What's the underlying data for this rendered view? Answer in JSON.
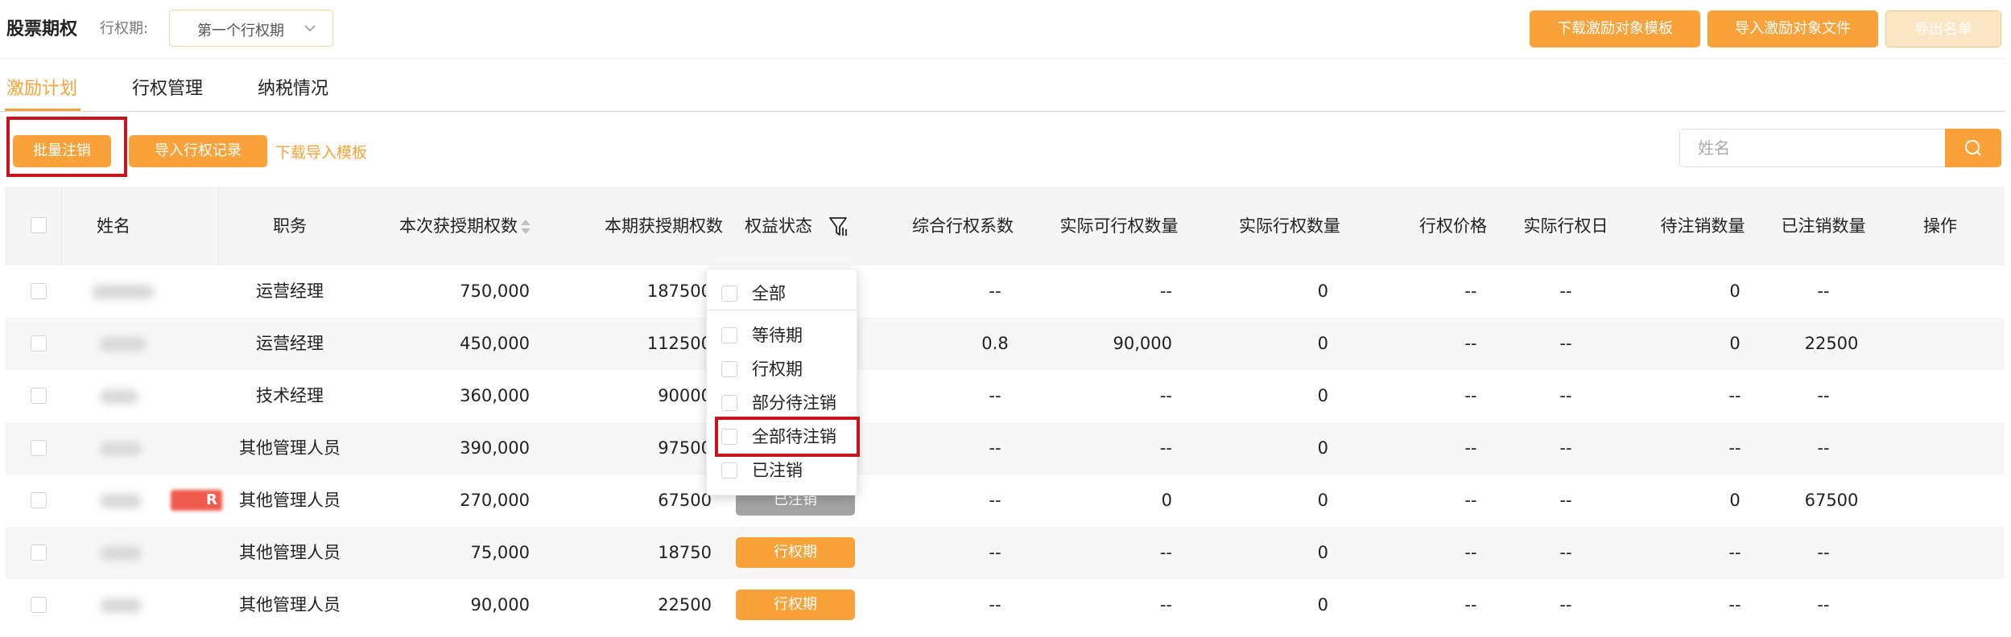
{
  "header": {
    "title": "股票期权",
    "period_label": "行权期:",
    "period_value": "第一个行权期",
    "buttons": {
      "download_template": "下载激励对象模板",
      "import_file": "导入激励对象文件",
      "export_list": "导出名单"
    }
  },
  "tabs": [
    {
      "label": "激励计划",
      "active": true
    },
    {
      "label": "行权管理",
      "active": false
    },
    {
      "label": "纳税情况",
      "active": false
    }
  ],
  "toolbar": {
    "batch_cancel": "批量注销",
    "import_records": "导入行权记录",
    "download_import_template": "下载导入模板",
    "search_placeholder": "姓名"
  },
  "table": {
    "headers": {
      "name": "姓名",
      "position": "职务",
      "granted": "本次获授期权数",
      "period_granted": "本期获授期权数",
      "status": "权益状态",
      "coefficient": "综合行权系数",
      "exercisable": "实际可行权数量",
      "exercised": "实际行权数量",
      "price": "行权价格",
      "exercise_date": "实际行权日",
      "pending_cancel": "待注销数量",
      "cancelled": "已注销数量",
      "action": "操作"
    },
    "rows": [
      {
        "position": "运营经理",
        "granted": "750,000",
        "period": "187500",
        "status": "",
        "coef": "--",
        "exercisable": "--",
        "exercised": "0",
        "price": "--",
        "date": "--",
        "pending": "0",
        "cancelled": "--"
      },
      {
        "position": "运营经理",
        "granted": "450,000",
        "period": "112500",
        "status": "",
        "coef": "0.8",
        "exercisable": "90,000",
        "exercised": "0",
        "price": "--",
        "date": "--",
        "pending": "0",
        "cancelled": "22500"
      },
      {
        "position": "技术经理",
        "granted": "360,000",
        "period": "90000",
        "status": "",
        "coef": "--",
        "exercisable": "--",
        "exercised": "0",
        "price": "--",
        "date": "--",
        "pending": "--",
        "cancelled": "--"
      },
      {
        "position": "其他管理人员",
        "granted": "390,000",
        "period": "97500",
        "status": "",
        "coef": "--",
        "exercisable": "--",
        "exercised": "0",
        "price": "--",
        "date": "--",
        "pending": "--",
        "cancelled": "--"
      },
      {
        "position": "其他管理人员",
        "granted": "270,000",
        "period": "67500",
        "status": "已注销",
        "coef": "--",
        "exercisable": "0",
        "exercised": "0",
        "price": "--",
        "date": "--",
        "pending": "0",
        "cancelled": "67500",
        "tag": "R"
      },
      {
        "position": "其他管理人员",
        "granted": "75,000",
        "period": "18750",
        "status": "行权期",
        "coef": "--",
        "exercisable": "--",
        "exercised": "0",
        "price": "--",
        "date": "--",
        "pending": "--",
        "cancelled": "--"
      },
      {
        "position": "其他管理人员",
        "granted": "90,000",
        "period": "22500",
        "status": "行权期",
        "coef": "--",
        "exercisable": "--",
        "exercised": "0",
        "price": "--",
        "date": "--",
        "pending": "--",
        "cancelled": "--"
      }
    ]
  },
  "status_filter": {
    "options": [
      "全部",
      "等待期",
      "行权期",
      "部分待注销",
      "全部待注销",
      "已注销"
    ]
  },
  "colors": {
    "accent": "#f8a239",
    "highlight": "#c8141d",
    "disabled_status": "#a3a3a3"
  },
  "icons": [
    "chevron-down-icon",
    "sort-icon",
    "filter-icon",
    "search-icon"
  ]
}
